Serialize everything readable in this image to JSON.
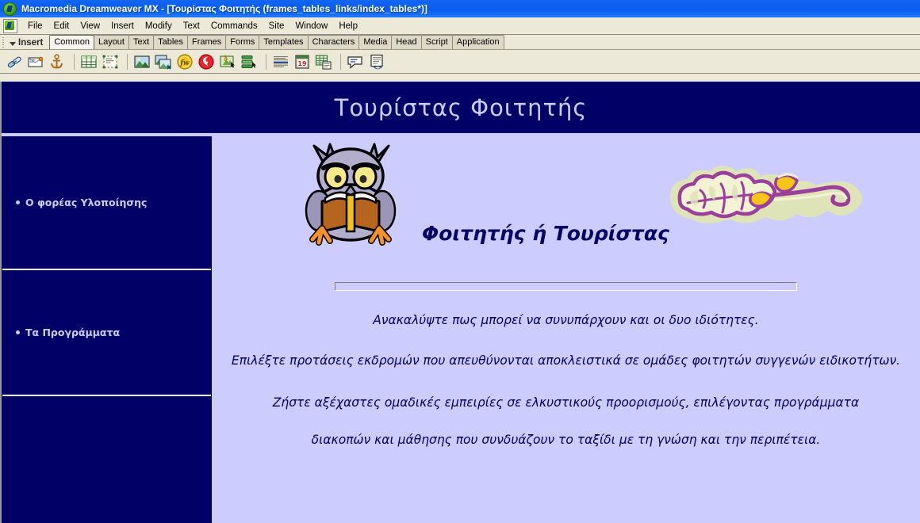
{
  "window": {
    "title": "Macromedia Dreamweaver MX  - [Τουρίστας Φοιτητής (frames_tables_links/index_tables*)]",
    "app_icon": "dreamweaver-icon"
  },
  "menubar": {
    "items": [
      "File",
      "Edit",
      "View",
      "Insert",
      "Modify",
      "Text",
      "Commands",
      "Site",
      "Window",
      "Help"
    ]
  },
  "insertbar": {
    "panel_label": "Insert",
    "tabs": [
      {
        "label": "Common",
        "active": true
      },
      {
        "label": "Layout",
        "active": false
      },
      {
        "label": "Text",
        "active": false
      },
      {
        "label": "Tables",
        "active": false
      },
      {
        "label": "Frames",
        "active": false
      },
      {
        "label": "Forms",
        "active": false
      },
      {
        "label": "Templates",
        "active": false
      },
      {
        "label": "Characters",
        "active": false
      },
      {
        "label": "Media",
        "active": false
      },
      {
        "label": "Head",
        "active": false
      },
      {
        "label": "Script",
        "active": false
      },
      {
        "label": "Application",
        "active": false
      }
    ]
  },
  "toolbar": {
    "icons": [
      "hyperlink-icon",
      "email-link-icon",
      "named-anchor-icon",
      "insert-table-icon",
      "draw-layer-icon",
      "insert-image-icon",
      "insert-rollover-image-icon",
      "insert-fireworks-html-icon",
      "insert-flash-icon",
      "insert-flash-button-icon",
      "insert-navigation-bar-icon",
      "horizontal-rule-icon",
      "date-icon",
      "tabular-data-icon",
      "comment-icon",
      "script-icon"
    ]
  },
  "page": {
    "banner_title": "Τουρίστας Φοιτητής",
    "sidebar": {
      "items": [
        {
          "label": "Ο φορέας Υλοποίησης"
        },
        {
          "label": "Τα Προγράμματα"
        }
      ]
    },
    "hero": {
      "heading": "Φοιτητής ή Τουρίστας",
      "owl_image_alt": "owl-reading-book-image",
      "leaf_image_alt": "oak-leaf-acorns-image"
    },
    "paragraphs": [
      "Ανακαλύψτε πως μπορεί να συνυπάρχουν και οι δυο ιδιότητες.",
      "Επιλέξτε προτάσεις εκδρομών που απευθύνονται αποκλειστικά σε ομάδες φοιτητών συγγενών ειδικοτήτων.",
      "Ζήστε αξέχαστες ομαδικές εμπειρίες σε ελκυστικούς προορισμούς, επιλέγοντας προγράμματα",
      "διακοπών και μάθησης που συνδυάζουν το ταξίδι με τη γνώση και την περιπέτεια."
    ]
  },
  "colors": {
    "navy": "#000066",
    "page_background": "#ccccff",
    "chrome": "#ece9d8",
    "titlebar_blue": "#0a5bef",
    "divider_white": "#ffffff"
  }
}
